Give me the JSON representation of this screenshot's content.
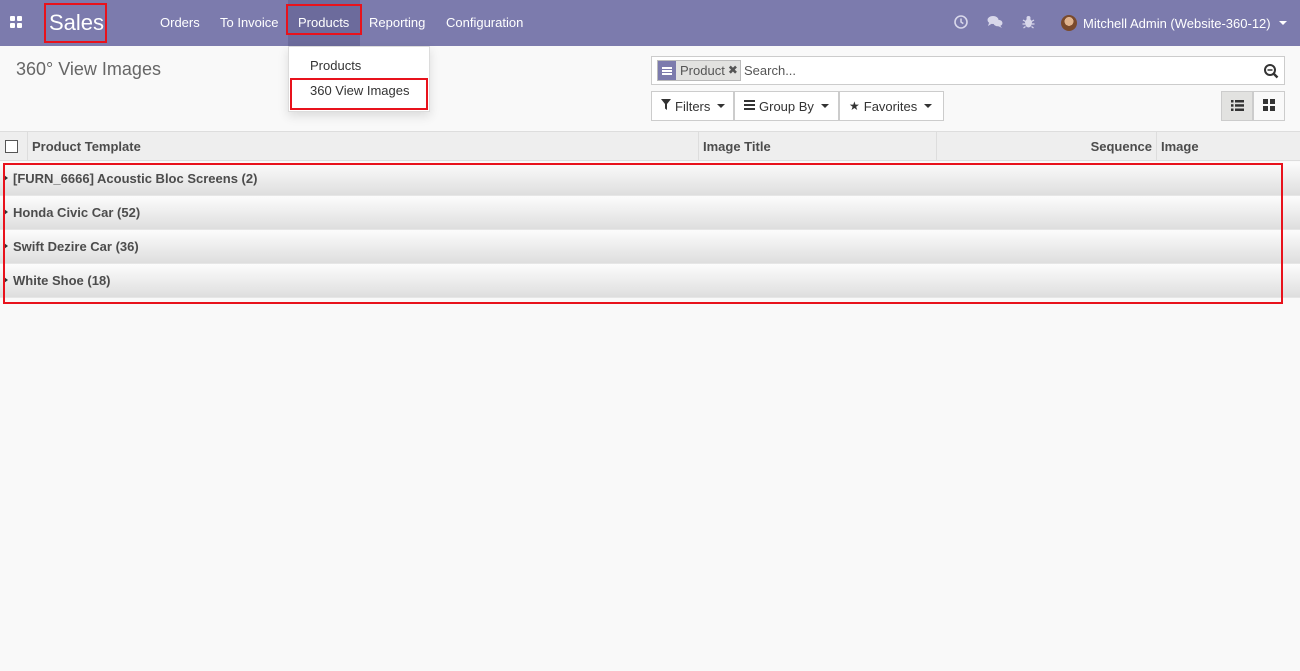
{
  "navbar": {
    "brand": "Sales",
    "menus": [
      "Orders",
      "To Invoice",
      "Products",
      "Reporting",
      "Configuration"
    ],
    "user_name": "Mitchell Admin (Website-360-12)"
  },
  "products_dropdown": {
    "items": [
      "Products",
      "360 View Images"
    ]
  },
  "control_panel": {
    "title": "360° View Images",
    "facet_label": "Product",
    "search_placeholder": "Search...",
    "filters_label": "Filters",
    "groupby_label": "Group By",
    "favorites_label": "Favorites"
  },
  "list": {
    "columns": [
      "Product Template",
      "Image Title",
      "Sequence",
      "Image"
    ],
    "groups": [
      "[FURN_6666] Acoustic Bloc Screens (2)",
      "Honda Civic Car (52)",
      "Swift Dezire Car (36)",
      "White Shoe (18)"
    ]
  },
  "colors": {
    "navbar": "#7c7bad",
    "highlight": "#e8121c",
    "background": "#f9f9f9"
  }
}
